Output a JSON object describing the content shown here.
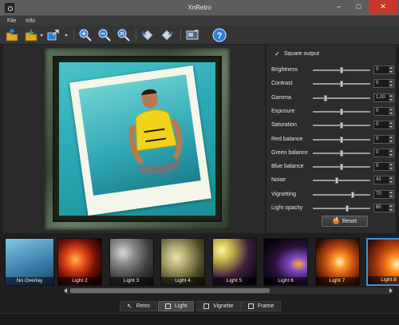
{
  "window": {
    "title": "XnRetro",
    "controls": [
      "–",
      "□",
      "✕"
    ]
  },
  "menu": {
    "items": [
      "File",
      "Info"
    ]
  },
  "toolbar": {
    "buttons": [
      "open-icon",
      "save-icon",
      "share-icon",
      "zoom-in-icon",
      "zoom-out-icon",
      "zoom-fit-icon",
      "rotate-left-icon",
      "rotate-right-icon",
      "fullscreen-icon",
      "help-icon"
    ]
  },
  "settings": {
    "square_output_label": "Square output",
    "square_output_checked": true,
    "sliders": [
      {
        "label": "Brightness",
        "value": "0",
        "level": 0.5
      },
      {
        "label": "Contrast",
        "value": "0",
        "level": 0.5
      },
      {
        "label": "Gamma",
        "value": "1,00",
        "level": 0.22
      },
      {
        "label": "Exposure",
        "value": "0",
        "level": 0.5
      },
      {
        "label": "Saturation",
        "value": "0",
        "level": 0.5
      },
      {
        "label": "Red balance",
        "value": "0",
        "level": 0.5
      },
      {
        "label": "Green balance",
        "value": "0",
        "level": 0.5
      },
      {
        "label": "Blue balance",
        "value": "0",
        "level": 0.5
      },
      {
        "label": "Noise",
        "value": "41",
        "level": 0.41
      },
      {
        "label": "Vignetting",
        "value": "70",
        "level": 0.7
      },
      {
        "label": "Light opacity",
        "value": "60",
        "level": 0.6
      }
    ],
    "reset_label": "Reset"
  },
  "effects": [
    {
      "label": "No Overlay",
      "selected": false
    },
    {
      "label": "Light 2",
      "selected": false
    },
    {
      "label": "Light 3",
      "selected": false
    },
    {
      "label": "Light 4",
      "selected": false
    },
    {
      "label": "Light 5",
      "selected": false
    },
    {
      "label": "Light 6",
      "selected": false
    },
    {
      "label": "Light 7",
      "selected": false
    },
    {
      "label": "Light 8",
      "selected": true
    }
  ],
  "tabs": [
    {
      "label": "Retro",
      "active": false
    },
    {
      "label": "Light",
      "active": true
    },
    {
      "label": "Vignette",
      "active": false
    },
    {
      "label": "Frame",
      "active": false
    }
  ],
  "colors": {
    "accent": "#3f8fd8",
    "titlebar": "#5f5c5c",
    "close": "#c7382a"
  }
}
